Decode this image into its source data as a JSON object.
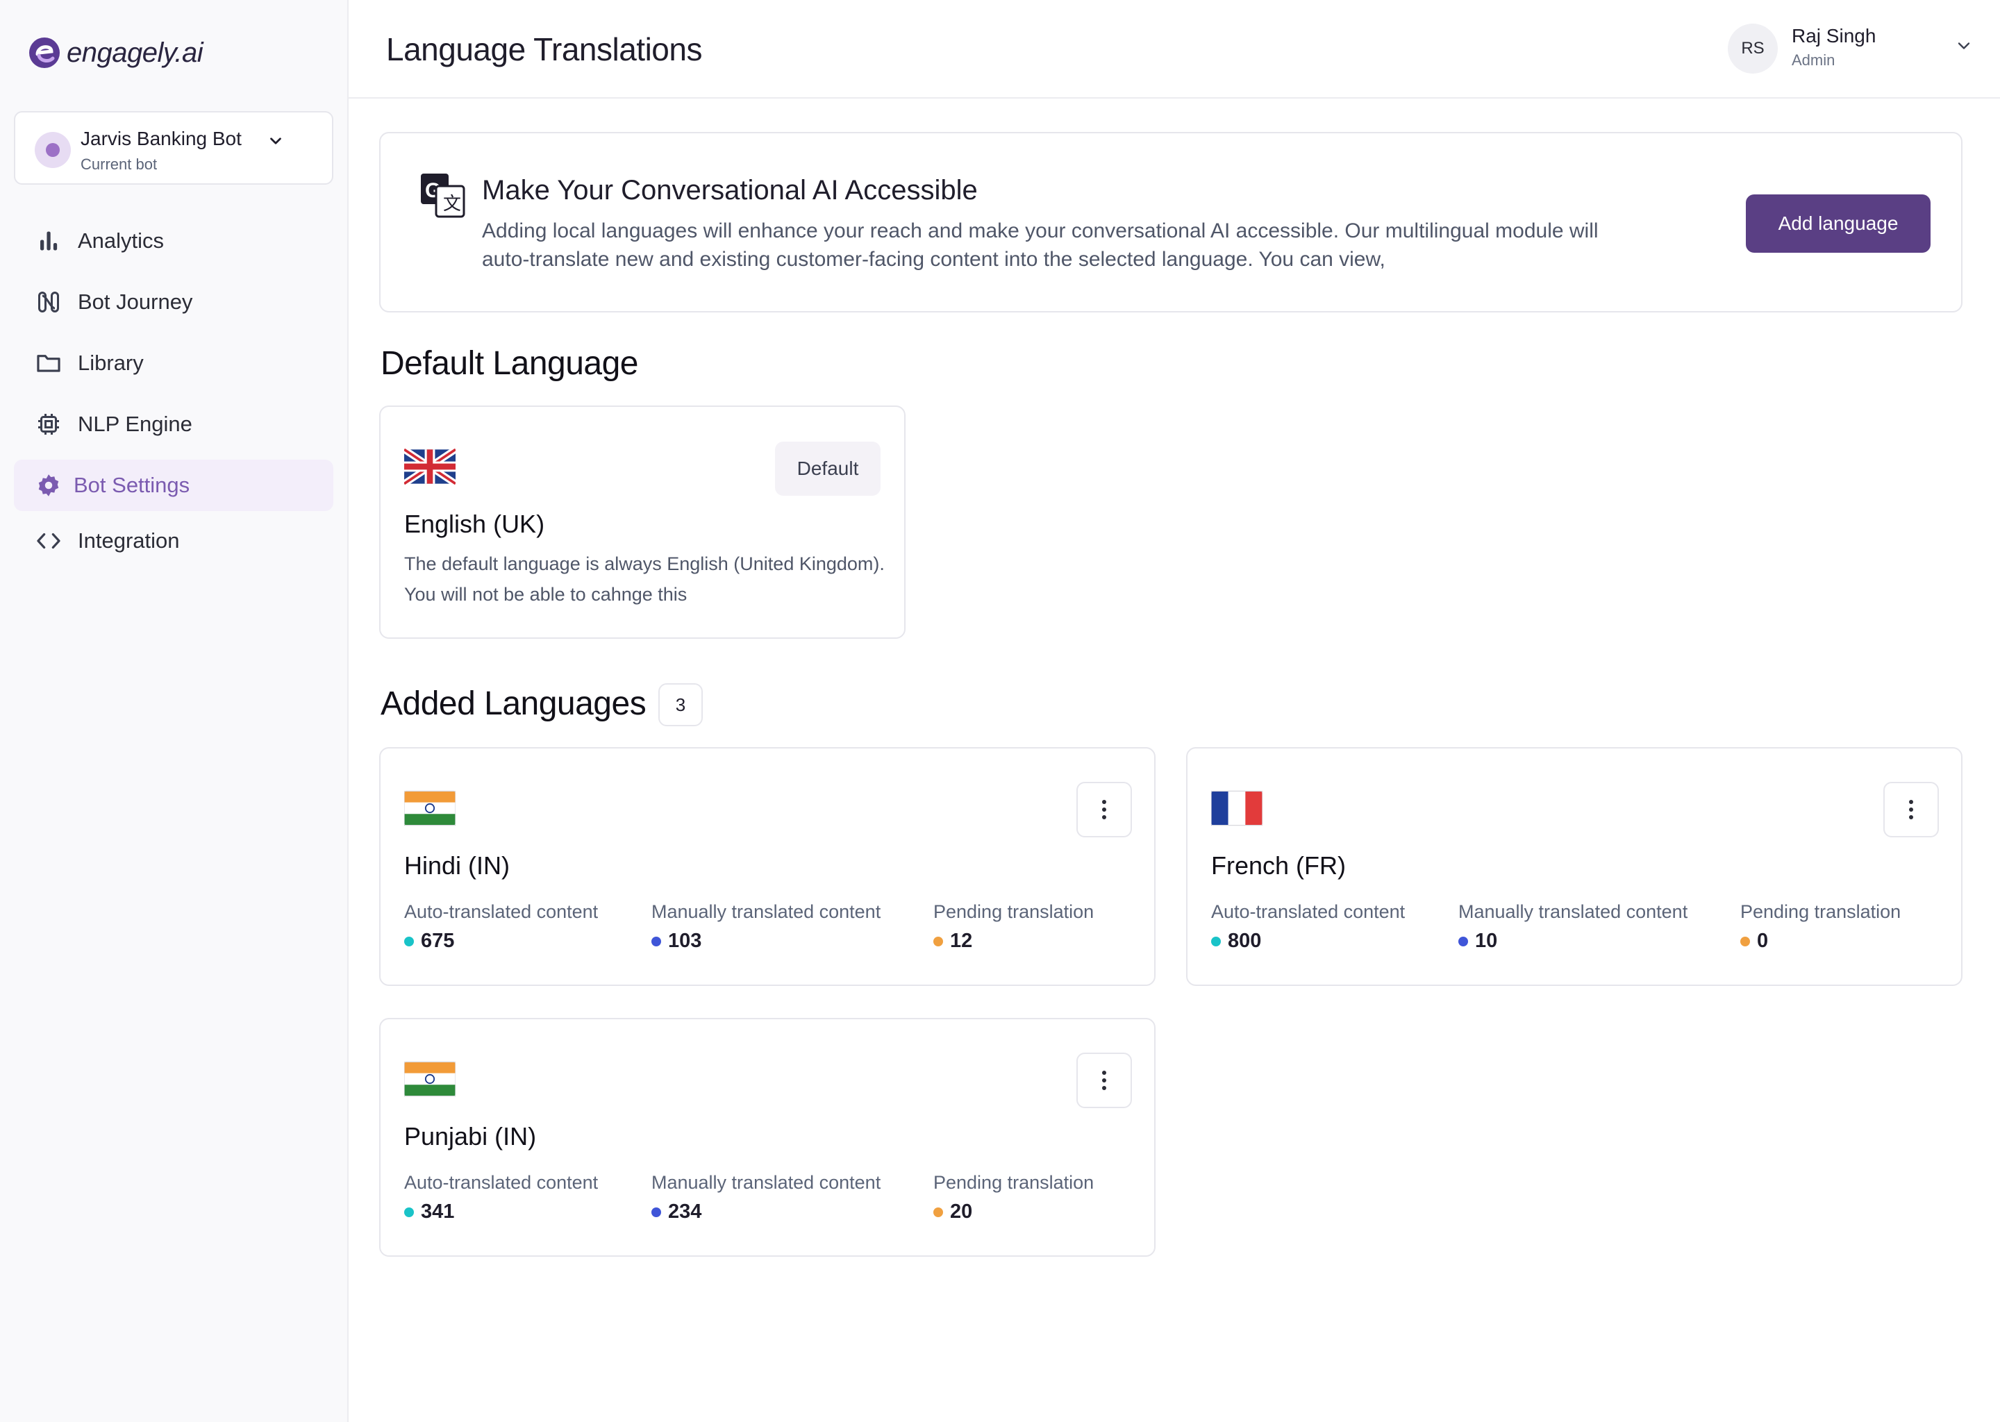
{
  "brand": {
    "name": "engagely.ai"
  },
  "bot": {
    "name": "Jarvis Banking Bot",
    "subtitle": "Current bot"
  },
  "nav": [
    {
      "label": "Analytics",
      "icon": "bar-chart-icon",
      "active": false
    },
    {
      "label": "Bot Journey",
      "icon": "journey-icon",
      "active": false
    },
    {
      "label": "Library",
      "icon": "folder-icon",
      "active": false
    },
    {
      "label": "NLP Engine",
      "icon": "chip-icon",
      "active": false
    },
    {
      "label": "Bot Settings",
      "icon": "gear-icon",
      "active": true
    },
    {
      "label": "Integration",
      "icon": "code-icon",
      "active": false
    }
  ],
  "header": {
    "title": "Language Translations"
  },
  "user": {
    "initials": "RS",
    "name": "Raj Singh",
    "role": "Admin"
  },
  "banner": {
    "title": "Make Your Conversational AI Accessible",
    "description": "Adding local languages will enhance your reach and make your conversational AI accessible. Our multilingual module will auto-translate new and existing customer-facing content into the selected language. You can view,",
    "button_label": "Add language"
  },
  "default_section": {
    "title": "Default Language",
    "language": "English (UK)",
    "badge": "Default",
    "description": "The default language is always English (United Kingdom). You will not be able to cahnge this"
  },
  "added_section": {
    "title": "Added Languages",
    "count": "3"
  },
  "stat_labels": {
    "auto": "Auto-translated content",
    "manual": "Manually translated content",
    "pending": "Pending translation"
  },
  "colors": {
    "auto": "#19c3c8",
    "manual": "#3f55d8",
    "pending": "#f0a040",
    "accent": "#5a3f84"
  },
  "languages": [
    {
      "name": "Hindi (IN)",
      "flag": "india-flag-icon",
      "auto": "675",
      "manual": "103",
      "pending": "12"
    },
    {
      "name": "French (FR)",
      "flag": "france-flag-icon",
      "auto": "800",
      "manual": "10",
      "pending": "0"
    },
    {
      "name": "Punjabi (IN)",
      "flag": "india-flag-icon",
      "auto": "341",
      "manual": "234",
      "pending": "20"
    }
  ]
}
